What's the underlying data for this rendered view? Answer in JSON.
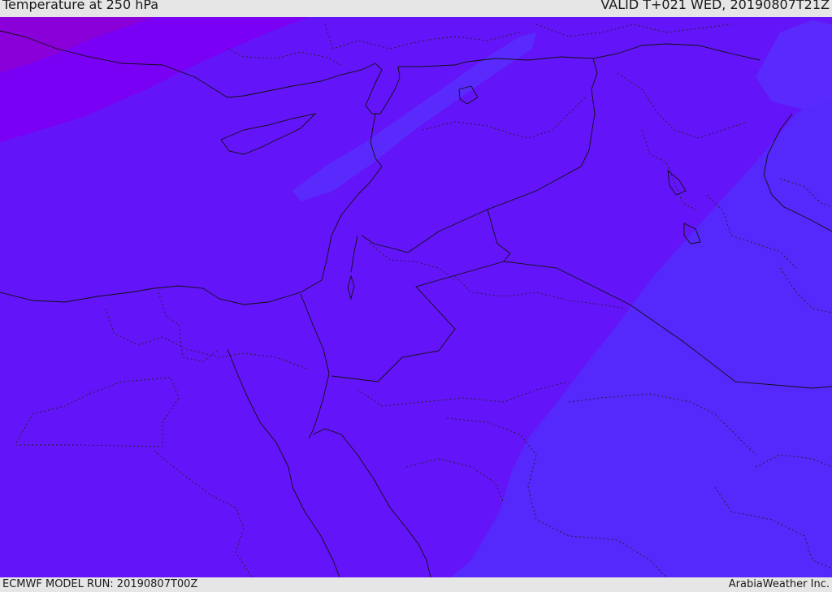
{
  "header": {
    "title": "Temperature at 250 hPa",
    "valid": "VALID T+021 WED, 20190807T21Z"
  },
  "footer": {
    "model_run": "ECMWF MODEL RUN: 20190807T00Z",
    "credit": "ArabiaWeather Inc."
  },
  "colors": {
    "base": "#6414f8",
    "warm_band": "#7a00f5",
    "warm_corner": "#8a00d8",
    "cool_band": "#5528fb",
    "cool_streak": "#5a2afc",
    "lines": "#101010"
  }
}
